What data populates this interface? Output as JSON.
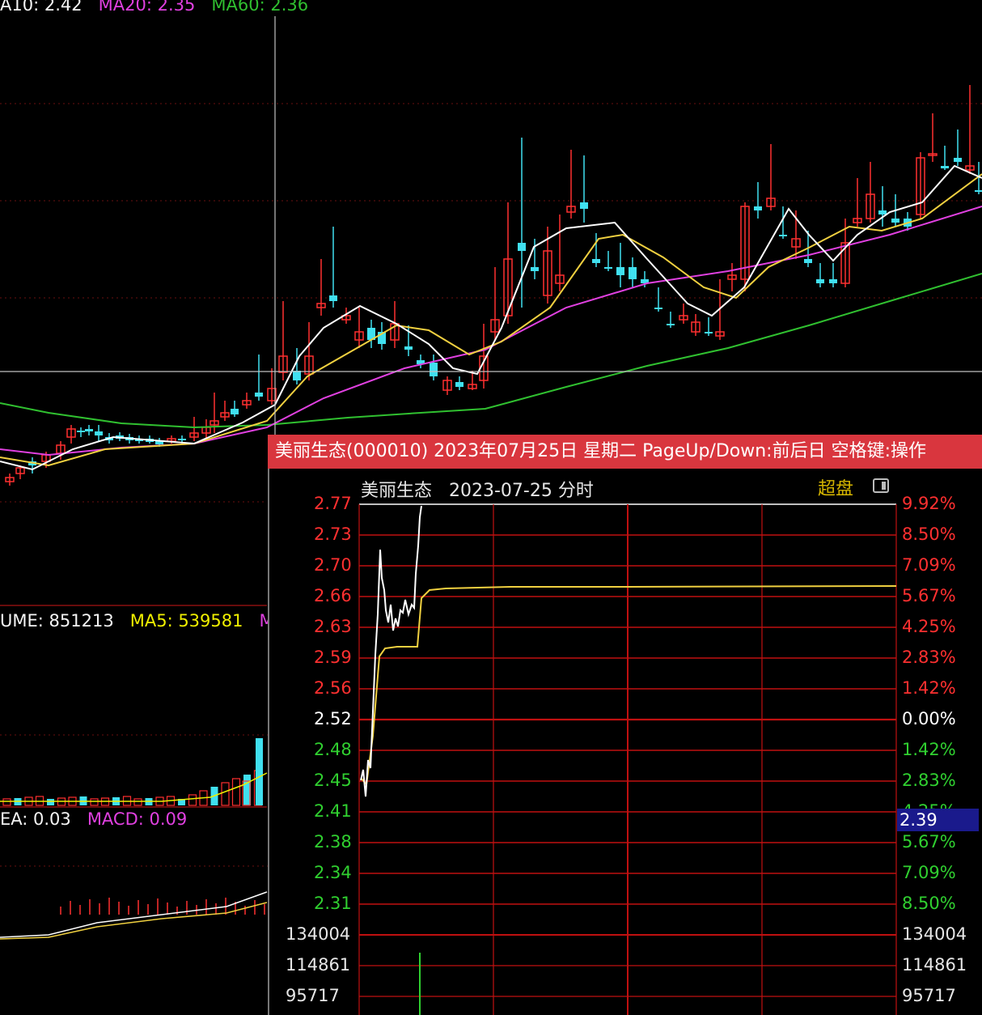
{
  "kline": {
    "ma_legend": [
      {
        "text": "A10: 2.42",
        "color": "#f5f5f5"
      },
      {
        "text": "MA20: 2.35",
        "color": "#e040e0"
      },
      {
        "text": "MA60: 2.36",
        "color": "#30c030"
      }
    ],
    "volume_legend": [
      {
        "text": "UME: 851213",
        "color": "#f5f5f5"
      },
      {
        "text": "MA5: 539581",
        "color": "#f0f000"
      },
      {
        "text": "MA",
        "color": "#e040e0"
      }
    ],
    "macd_legend": [
      {
        "text": "EA: 0.03",
        "color": "#f5f5f5"
      },
      {
        "text": "MACD: 0.09",
        "color": "#e040e0"
      }
    ],
    "colors": {
      "up": "#ff3030",
      "down": "#40e0f0",
      "ma5": "#ffffff",
      "ma10": "#f0d040",
      "ma20": "#e040e0",
      "ma60": "#30c030"
    }
  },
  "popup": {
    "title": "美丽生态(000010) 2023年07月25日 星期二 PageUp/Down:前后日 空格键:操作",
    "stock_name": "美丽生态",
    "date_label": "2023-07-25 分时",
    "super_label": "超盘",
    "current_price": "2.39",
    "left_ticks": [
      {
        "label": "2.77",
        "color": "#ff3030"
      },
      {
        "label": "2.73",
        "color": "#ff3030"
      },
      {
        "label": "2.70",
        "color": "#ff3030"
      },
      {
        "label": "2.66",
        "color": "#ff3030"
      },
      {
        "label": "2.63",
        "color": "#ff3030"
      },
      {
        "label": "2.59",
        "color": "#ff3030"
      },
      {
        "label": "2.56",
        "color": "#ff3030"
      },
      {
        "label": "2.52",
        "color": "#ffffff"
      },
      {
        "label": "2.48",
        "color": "#30d030"
      },
      {
        "label": "2.45",
        "color": "#30d030"
      },
      {
        "label": "2.41",
        "color": "#30d030"
      },
      {
        "label": "2.38",
        "color": "#30d030"
      },
      {
        "label": "2.34",
        "color": "#30d030"
      },
      {
        "label": "2.31",
        "color": "#30d030"
      }
    ],
    "right_ticks": [
      {
        "label": "9.92%",
        "color": "#ff3030"
      },
      {
        "label": "8.50%",
        "color": "#ff3030"
      },
      {
        "label": "7.09%",
        "color": "#ff3030"
      },
      {
        "label": "5.67%",
        "color": "#ff3030"
      },
      {
        "label": "4.25%",
        "color": "#ff3030"
      },
      {
        "label": "2.83%",
        "color": "#ff3030"
      },
      {
        "label": "1.42%",
        "color": "#ff3030"
      },
      {
        "label": "0.00%",
        "color": "#ffffff"
      },
      {
        "label": "1.42%",
        "color": "#30d030"
      },
      {
        "label": "2.83%",
        "color": "#30d030"
      },
      {
        "label": "4.25%",
        "color": "#30d030"
      },
      {
        "label": "5.67%",
        "color": "#30d030"
      },
      {
        "label": "7.09%",
        "color": "#30d030"
      },
      {
        "label": "8.50%",
        "color": "#30d030"
      }
    ],
    "volume_ticks": [
      "134004",
      "114861",
      "95717"
    ]
  },
  "chart_data": [
    {
      "type": "line",
      "title": "美丽生态 2023-07-25 分时",
      "series": [],
      "ylim": [
        2.31,
        2.77
      ],
      "prev_close": 2.52
    }
  ]
}
